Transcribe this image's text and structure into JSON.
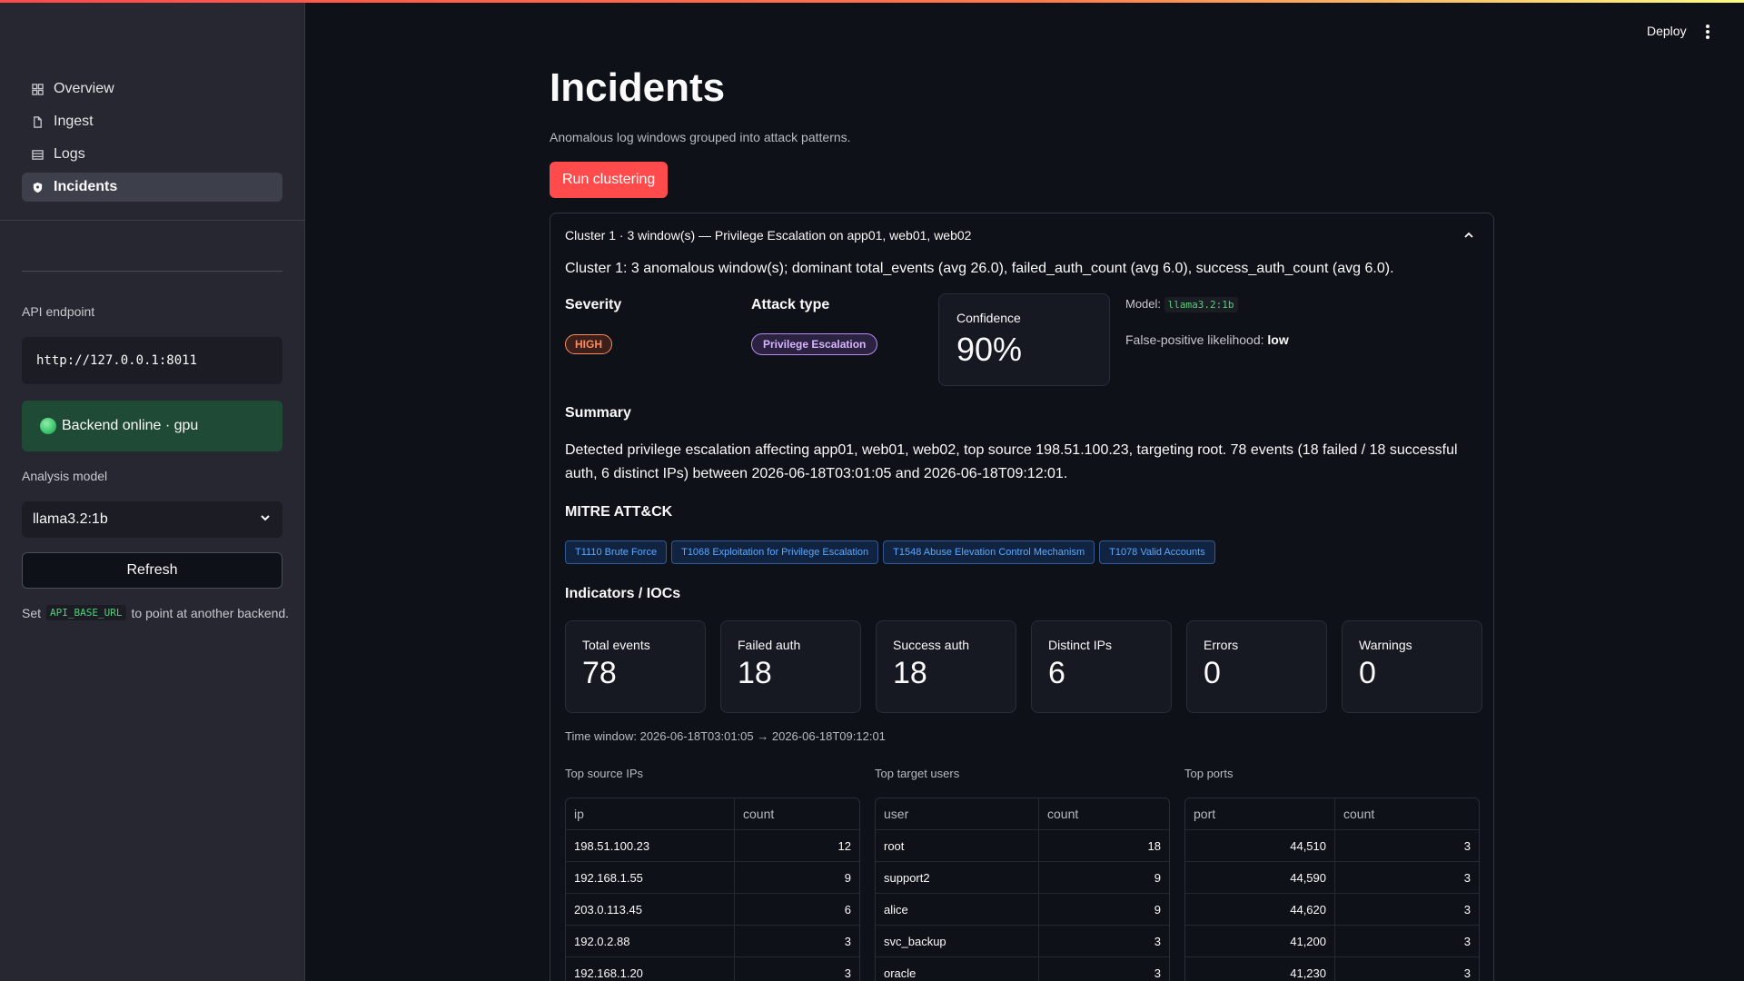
{
  "header": {
    "deploy_label": "Deploy"
  },
  "sidebar": {
    "nav": [
      {
        "label": "Overview",
        "icon": "grid-icon",
        "active": false
      },
      {
        "label": "Ingest",
        "icon": "file-icon",
        "active": false
      },
      {
        "label": "Logs",
        "icon": "table-icon",
        "active": false
      },
      {
        "label": "Incidents",
        "icon": "shield-icon",
        "active": true
      }
    ],
    "api_label": "API endpoint",
    "api_value": "http://127.0.0.1:8011",
    "status_text": "Backend online · gpu",
    "model_label": "Analysis model",
    "model_value": "llama3.2:1b",
    "refresh_label": "Refresh",
    "note_pre": "Set",
    "note_code": "API_BASE_URL",
    "note_post": "to point at another backend."
  },
  "main": {
    "title": "Incidents",
    "subtitle": "Anomalous log windows grouped into attack patterns.",
    "run_button": "Run clustering",
    "cluster": {
      "header": "Cluster 1 · 3 window(s) — Privilege Escalation on app01, web01, web02",
      "description": "Cluster 1: 3 anomalous window(s); dominant total_events (avg 26.0), failed_auth_count (avg 6.0), success_auth_count (avg 6.0).",
      "severity_label": "Severity",
      "severity_value": "HIGH",
      "attack_label": "Attack type",
      "attack_value": "Privilege Escalation",
      "confidence_label": "Confidence",
      "confidence_value": "90%",
      "model_label": "Model:",
      "model_value": "llama3.2:1b",
      "fp_label": "False-positive likelihood:",
      "fp_value": "low",
      "summary_label": "Summary",
      "summary_text": "Detected privilege escalation affecting app01, web01, web02, top source 198.51.100.23, targeting root. 78 events (18 failed / 18 successful auth, 6 distinct IPs) between 2026-06-18T03:01:05 and 2026-06-18T09:12:01.",
      "mitre_label": "MITRE ATT&CK",
      "mitre": [
        "T1110 Brute Force",
        "T1068 Exploitation for Privilege Escalation",
        "T1548 Abuse Elevation Control Mechanism",
        "T1078 Valid Accounts"
      ],
      "ioc_label": "Indicators / IOCs",
      "metrics": [
        {
          "label": "Total events",
          "value": "78"
        },
        {
          "label": "Failed auth",
          "value": "18"
        },
        {
          "label": "Success auth",
          "value": "18"
        },
        {
          "label": "Distinct IPs",
          "value": "6"
        },
        {
          "label": "Errors",
          "value": "0"
        },
        {
          "label": "Warnings",
          "value": "0"
        }
      ],
      "time_window": "Time window: 2026-06-18T03:01:05 → 2026-06-18T09:12:01",
      "tables": {
        "ips": {
          "label": "Top source IPs",
          "columns": [
            "ip",
            "count"
          ],
          "rows": [
            [
              "198.51.100.23",
              "12"
            ],
            [
              "192.168.1.55",
              "9"
            ],
            [
              "203.0.113.45",
              "6"
            ],
            [
              "192.0.2.88",
              "3"
            ],
            [
              "192.168.1.20",
              "3"
            ]
          ]
        },
        "users": {
          "label": "Top target users",
          "columns": [
            "user",
            "count"
          ],
          "rows": [
            [
              "root",
              "18"
            ],
            [
              "support2",
              "9"
            ],
            [
              "alice",
              "9"
            ],
            [
              "svc_backup",
              "3"
            ],
            [
              "oracle",
              "3"
            ]
          ]
        },
        "ports": {
          "label": "Top ports",
          "columns": [
            "port",
            "count"
          ],
          "rows": [
            [
              "44,510",
              "3"
            ],
            [
              "44,590",
              "3"
            ],
            [
              "44,620",
              "3"
            ],
            [
              "41,200",
              "3"
            ],
            [
              "41,230",
              "3"
            ]
          ]
        }
      }
    }
  }
}
